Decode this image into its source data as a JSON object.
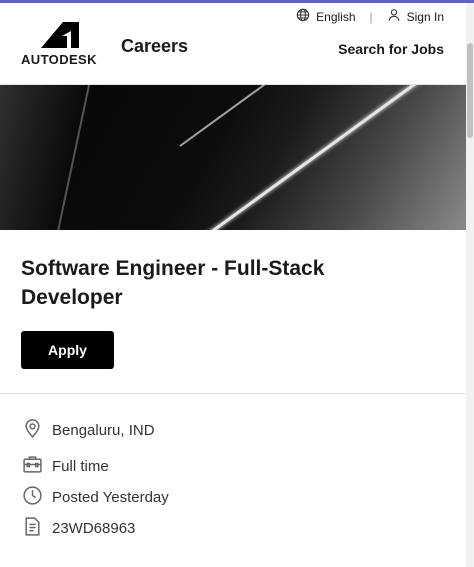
{
  "header": {
    "language_label": "English",
    "signin_label": "Sign In",
    "logo_text": "AUTODESK",
    "careers_label": "Careers",
    "search_jobs_label": "Search for Jobs"
  },
  "job": {
    "title": "Software Engineer - Full-Stack Developer",
    "apply_label": "Apply",
    "location": "Bengaluru, IND",
    "type": "Full time",
    "posted": "Posted Yesterday",
    "req_id": "23WD68963"
  },
  "icons": {
    "language": "globe-icon",
    "signin": "user-icon",
    "location": "location-pin-icon",
    "type": "briefcase-icon",
    "posted": "clock-icon",
    "req_id": "document-icon"
  },
  "colors": {
    "accent": "#5a5fd8",
    "button": "#000000",
    "text": "#1a1a1a"
  }
}
